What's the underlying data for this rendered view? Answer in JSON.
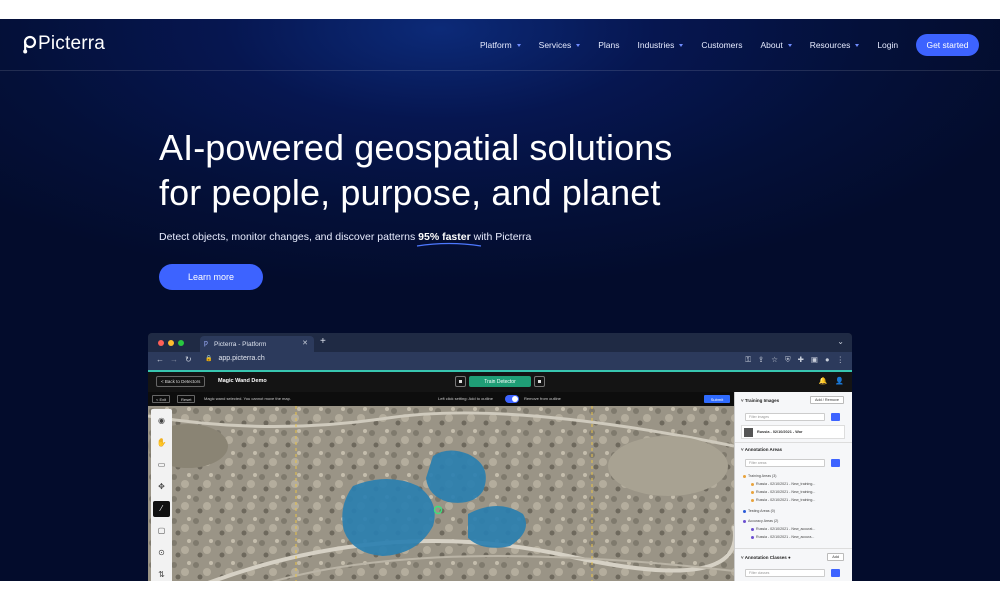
{
  "colors": {
    "accent": "#3d63ff",
    "hero_bg": "#041039",
    "train_green": "#1f9e76",
    "lake_blue": "#2a7fb0"
  },
  "brand": {
    "name": "Picterra",
    "logo_icon": "picterra-logo-icon"
  },
  "nav": {
    "items": [
      {
        "label": "Platform",
        "dropdown": true
      },
      {
        "label": "Services",
        "dropdown": true
      },
      {
        "label": "Plans",
        "dropdown": false
      },
      {
        "label": "Industries",
        "dropdown": true
      },
      {
        "label": "Customers",
        "dropdown": false
      },
      {
        "label": "About",
        "dropdown": true
      },
      {
        "label": "Resources",
        "dropdown": true
      },
      {
        "label": "Login",
        "dropdown": false
      }
    ],
    "cta": "Get started"
  },
  "hero": {
    "title_line1": "AI-powered geospatial solutions",
    "title_line2": "for people, purpose, and planet",
    "subtitle_pre": "Detect objects, monitor changes, and discover patterns",
    "subtitle_bold": "95% faster",
    "subtitle_post": "with Picterra",
    "button": "Learn more"
  },
  "browser": {
    "tab_title": "Picterra - Platform",
    "url": "app.picterra.ch",
    "app": {
      "back_button": "< Back to Detectors",
      "project_title": "Magic Wand Demo",
      "train_button": "Train Detector",
      "exit_button": "< Exit",
      "reset_button": "Reset",
      "status_message": "Magic wand selected. You cannot move the map.",
      "left_click_setting": "Left click setting:",
      "add_to_outline": "Add to outline",
      "remove_from_outline": "Remove from outline",
      "submit_button": "Submit",
      "tools": [
        "eye-icon",
        "hand-icon",
        "rectangle-icon",
        "move-icon",
        "magic-wand-icon",
        "square-icon",
        "zoom-icon",
        "arrows-icon"
      ]
    },
    "panel": {
      "training_images": "Training Images",
      "add_remove": "Add / Remove",
      "filter_images": "Filter images",
      "image_row": "Russia - 02/10/2021 - Wor",
      "annotation_areas": "Annotation Areas",
      "filter_areas": "Filter areas",
      "training_areas": "Training Areas (3)",
      "training_items": [
        "Russia - 02/10/2021 - New_training...",
        "Russia - 02/10/2021 - New_training...",
        "Russia - 02/10/2021 - New_training..."
      ],
      "testing_areas": "Testing Areas (0)",
      "accuracy_areas": "Accuracy Areas (2)",
      "accuracy_items": [
        "Russia - 02/10/2021 - New_accurat...",
        "Russia - 02/10/2021 - New_accura..."
      ],
      "annotation_classes": "Annotation Classes",
      "add": "Add",
      "filter_classes": "Filter classes"
    }
  }
}
